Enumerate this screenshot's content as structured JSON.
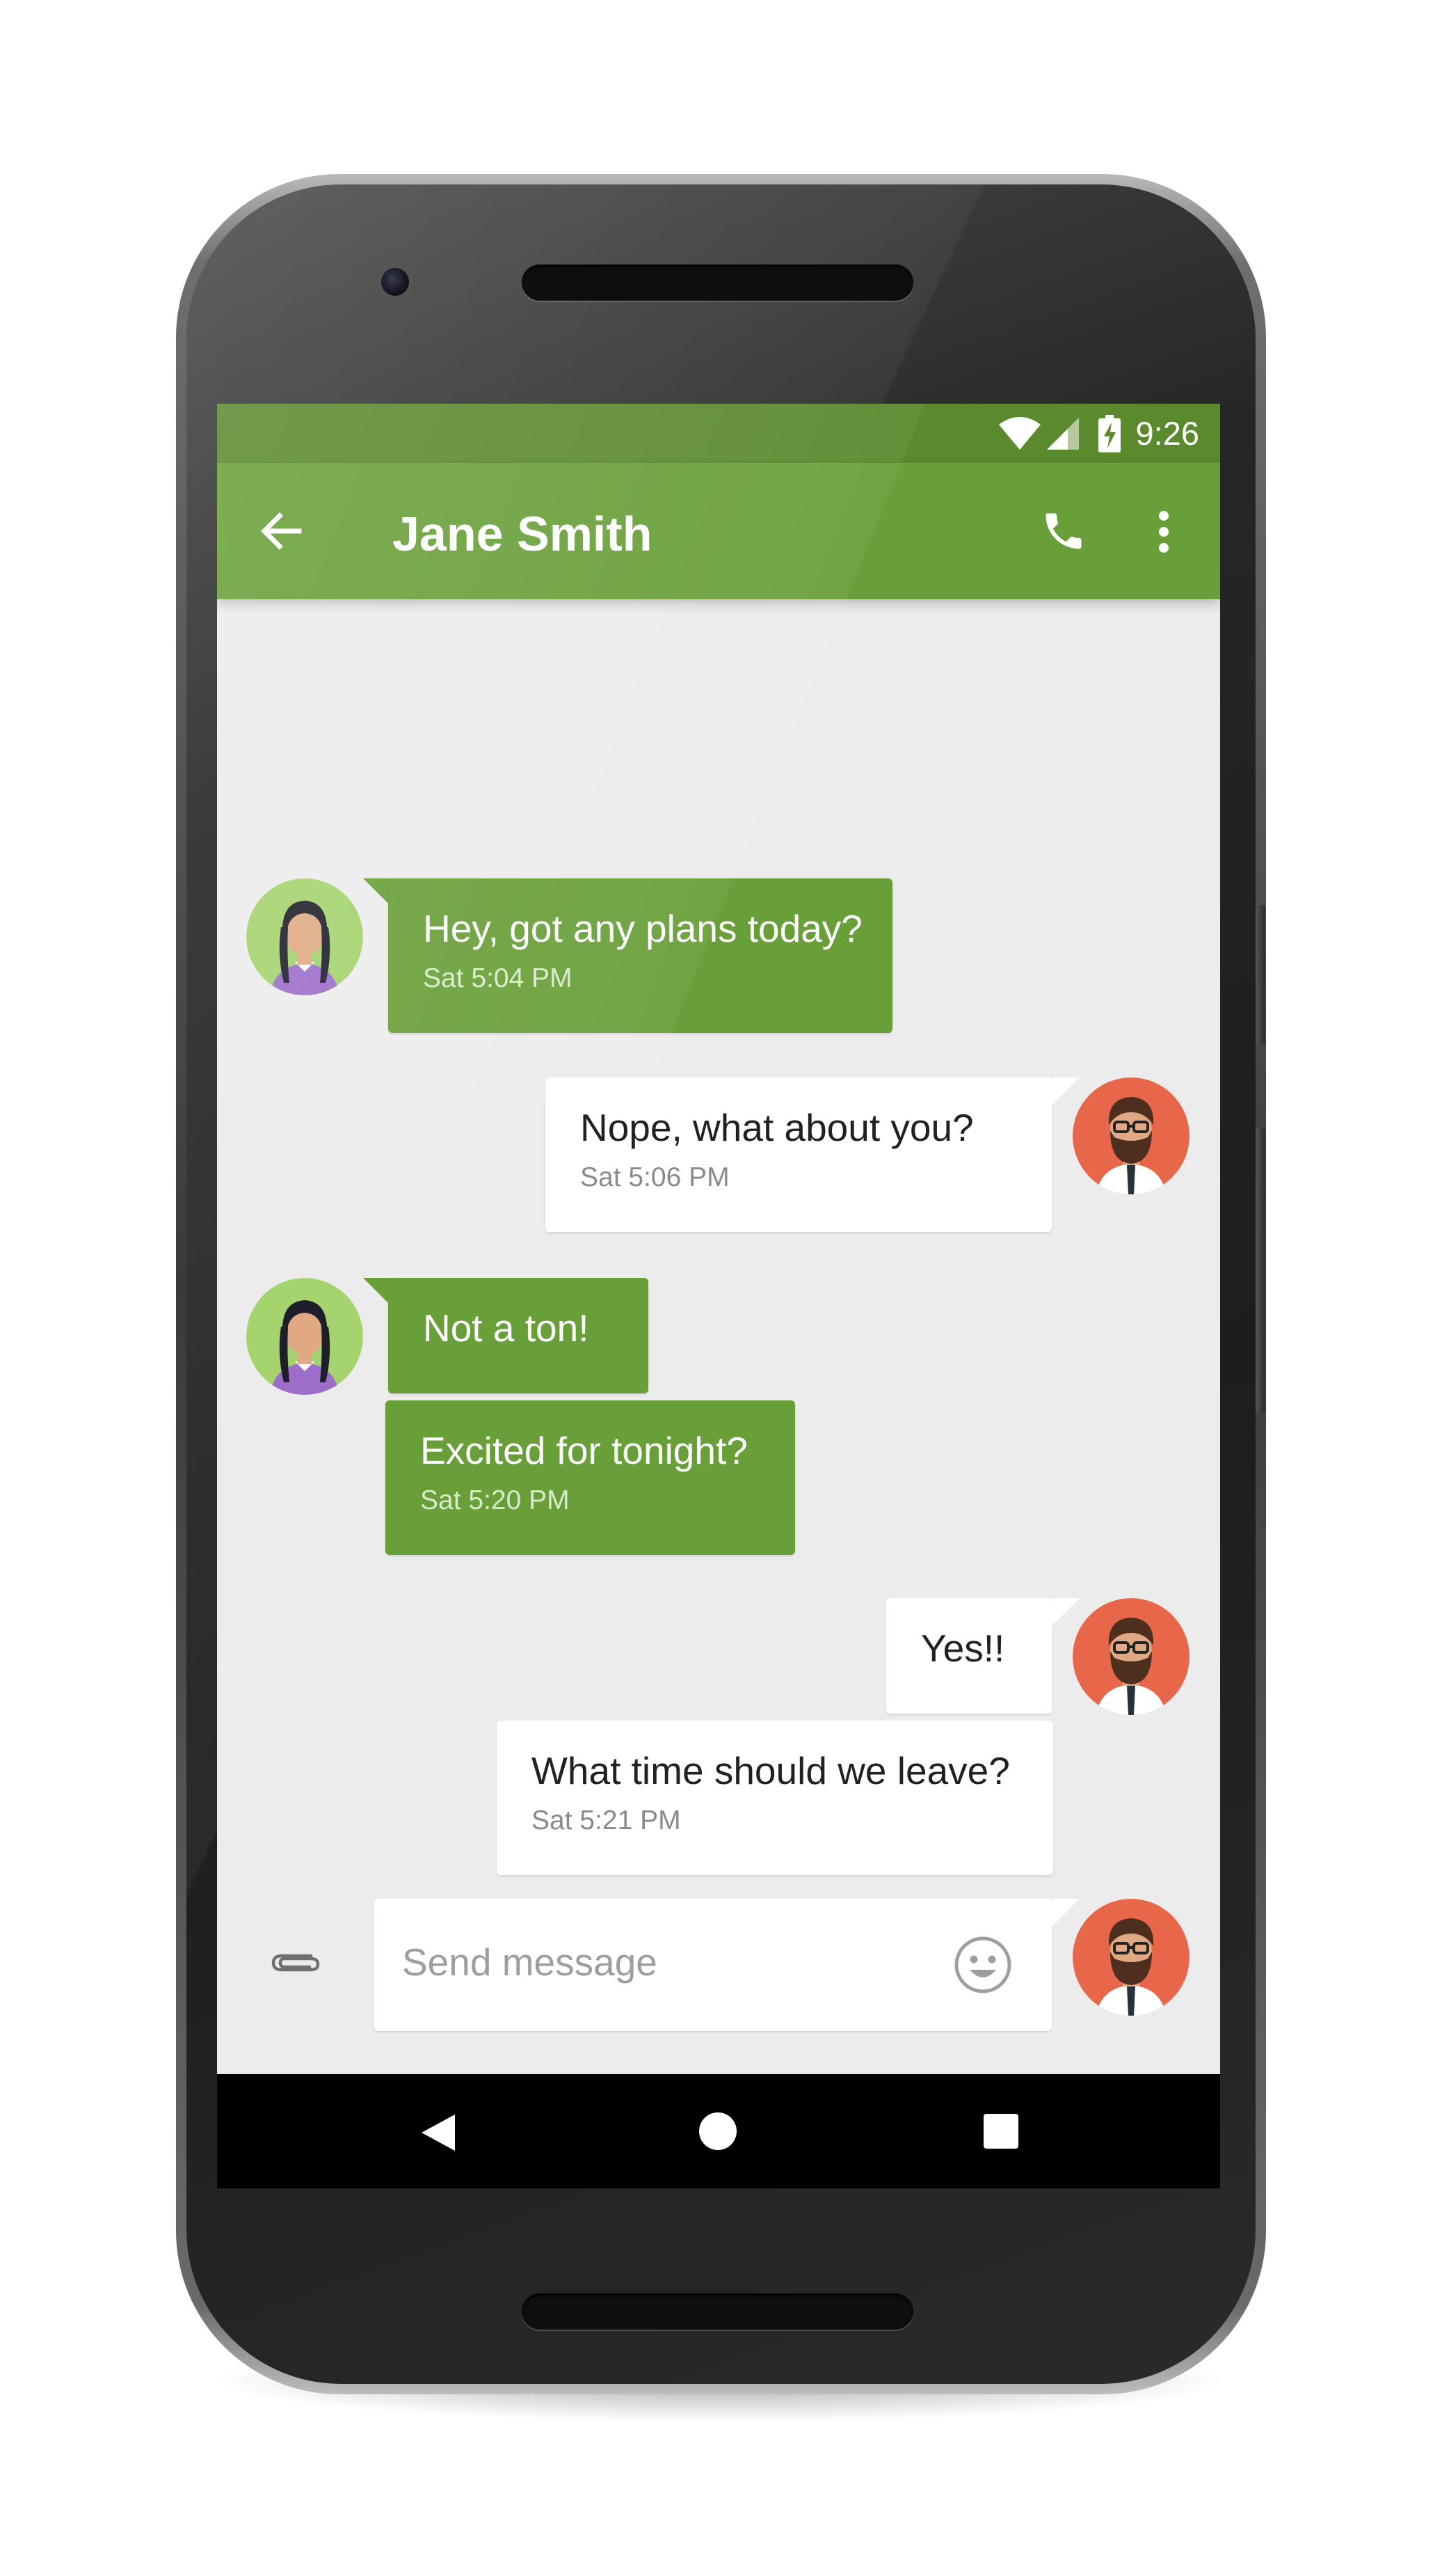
{
  "status_bar": {
    "time": "9:26",
    "icons": [
      "wifi-icon",
      "cell-signal-icon",
      "battery-charging-icon"
    ]
  },
  "app_bar": {
    "title": "Jane Smith",
    "color": "#689f38",
    "status_color": "#5b892e",
    "icons": [
      "back-arrow-icon",
      "phone-icon",
      "more-vert-icon"
    ]
  },
  "messages": [
    {
      "sender": "Jane Smith",
      "direction": "incoming",
      "text": "Hey, got any plans today?",
      "time": "Sat 5:04 PM"
    },
    {
      "sender": "me",
      "direction": "outgoing",
      "text": "Nope, what about you?",
      "time": "Sat 5:06 PM"
    },
    {
      "sender": "Jane Smith",
      "direction": "incoming",
      "text": "Not a ton!"
    },
    {
      "sender": "Jane Smith",
      "direction": "incoming",
      "text": "Excited for tonight?",
      "time": "Sat 5:20 PM"
    },
    {
      "sender": "me",
      "direction": "outgoing",
      "text": "Yes!!"
    },
    {
      "sender": "me",
      "direction": "outgoing",
      "text": "What time should we leave?",
      "time": "Sat 5:21 PM"
    }
  ],
  "composer": {
    "placeholder": "Send message",
    "icons": [
      "attachment-icon",
      "emoji-icon"
    ]
  },
  "nav_bar": {
    "icons": [
      "nav-back-icon",
      "nav-home-icon",
      "nav-recents-icon"
    ]
  },
  "colors": {
    "incoming_bubble": "#689f38",
    "outgoing_bubble": "#ffffff",
    "chat_background": "#ececec",
    "jane_avatar_bg": "#a5d36e",
    "user_avatar_bg": "#e8664a"
  }
}
